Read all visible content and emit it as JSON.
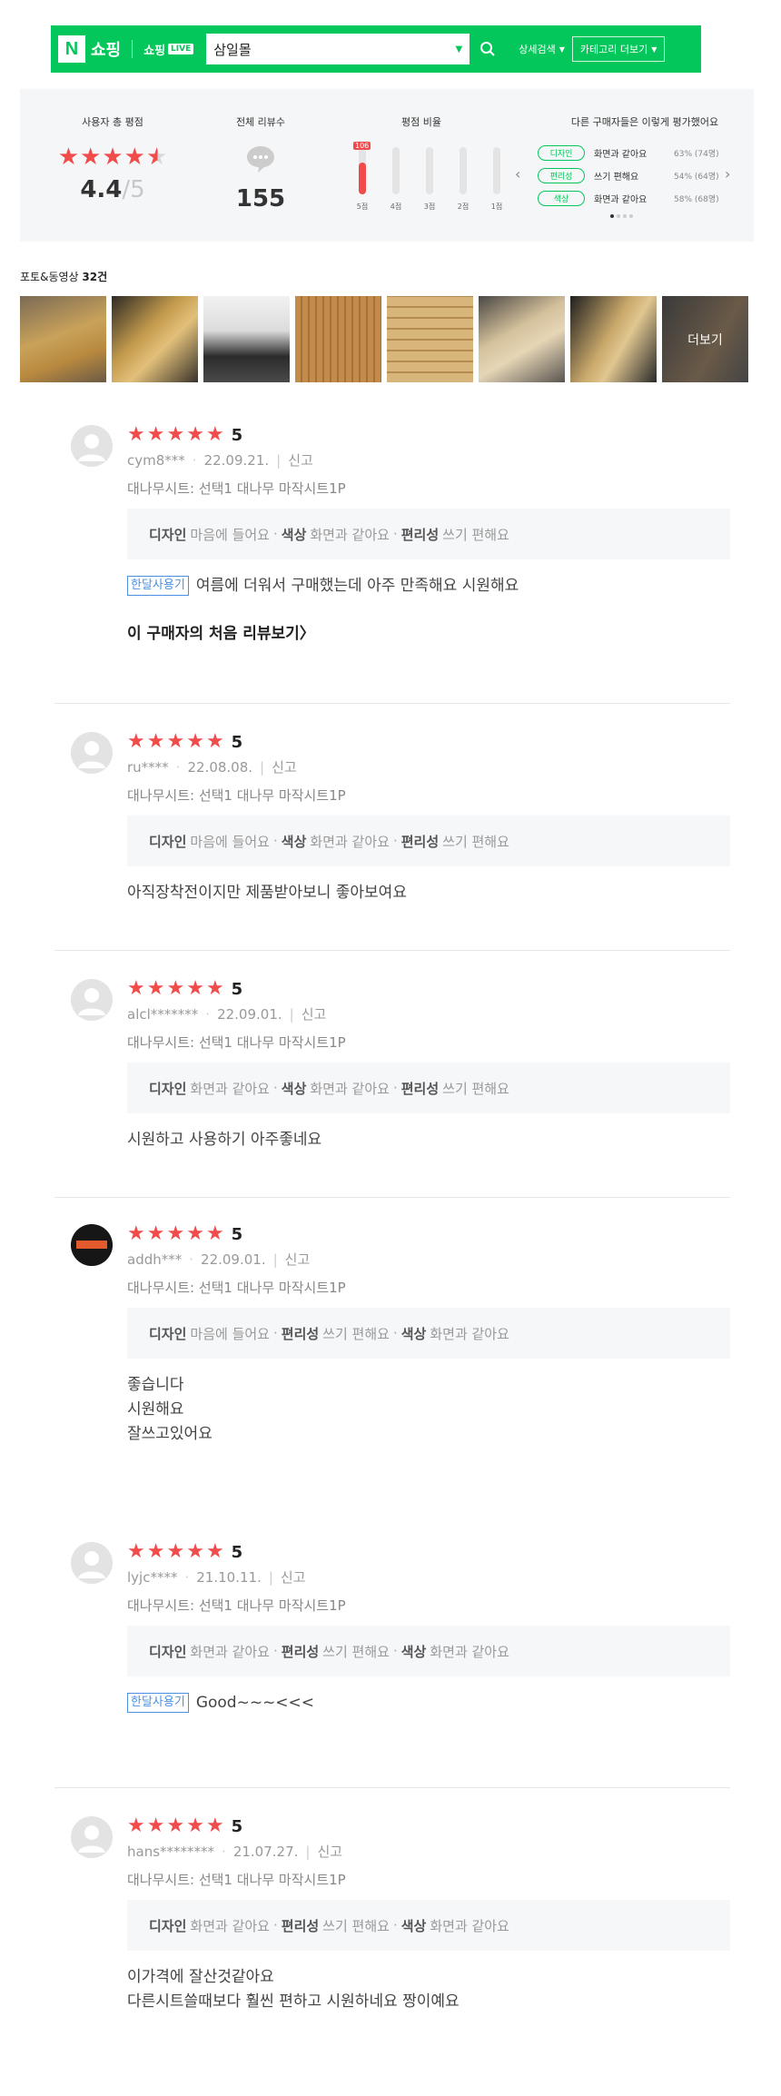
{
  "header": {
    "logo": "N",
    "shop": "쇼핑",
    "live_text": "쇼핑",
    "live_badge": "LIVE",
    "search_value": "삼일몰",
    "detail_search": "상세검색",
    "more_category": "카테고리 더보기"
  },
  "summary": {
    "user_rating_title": "사용자 총 평점",
    "avg": "4.4",
    "avg_max": "/5",
    "rating_value": 4.4,
    "total_title": "전체 리뷰수",
    "total": "155",
    "ratio_title": "평점 비율",
    "ratio": [
      {
        "label": "5점",
        "fraction": 0.68,
        "tag": "106"
      },
      {
        "label": "4점",
        "fraction": 0.0,
        "tag": ""
      },
      {
        "label": "3점",
        "fraction": 0.0,
        "tag": ""
      },
      {
        "label": "2점",
        "fraction": 0.0,
        "tag": ""
      },
      {
        "label": "1점",
        "fraction": 0.0,
        "tag": ""
      }
    ],
    "eval_title": "다른 구매자들은 이렇게 평가했어요",
    "evals": [
      {
        "tag": "디자인",
        "text": "화면과 같아요",
        "pct": "63% (74명)"
      },
      {
        "tag": "편리성",
        "text": "쓰기 편해요",
        "pct": "54% (64명)"
      },
      {
        "tag": "색상",
        "text": "화면과 같아요",
        "pct": "58% (68명)"
      }
    ]
  },
  "photos": {
    "title_prefix": "포토&동영상",
    "count": "32건",
    "more": "더보기"
  },
  "reviews": [
    {
      "score": "5",
      "user": "cym8***",
      "date": "22.09.21.",
      "report": "신고",
      "option": "대나무시트: 선택1 대나무 마작시트1P",
      "evals": [
        {
          "k": "디자인",
          "v": "마음에 들어요"
        },
        {
          "k": "색상",
          "v": "화면과 같아요"
        },
        {
          "k": "편리성",
          "v": "쓰기 편해요"
        }
      ],
      "tag": "한달사용기",
      "text": "여름에 더워서 구매했는데 아주 만족해요 시원해요",
      "first_review": "이 구매자의 처음 리뷰보기〉"
    },
    {
      "score": "5",
      "user": "ru****",
      "date": "22.08.08.",
      "report": "신고",
      "option": "대나무시트: 선택1 대나무 마작시트1P",
      "evals": [
        {
          "k": "디자인",
          "v": "마음에 들어요"
        },
        {
          "k": "색상",
          "v": "화면과 같아요"
        },
        {
          "k": "편리성",
          "v": "쓰기 편해요"
        }
      ],
      "text": "아직장착전이지만 제품받아보니 좋아보여요"
    },
    {
      "score": "5",
      "user": "alcl*******",
      "date": "22.09.01.",
      "report": "신고",
      "option": "대나무시트: 선택1 대나무 마작시트1P",
      "evals": [
        {
          "k": "디자인",
          "v": "화면과 같아요"
        },
        {
          "k": "색상",
          "v": "화면과 같아요"
        },
        {
          "k": "편리성",
          "v": "쓰기 편해요"
        }
      ],
      "text": "시원하고 사용하기 아주좋네요"
    },
    {
      "score": "5",
      "user": "addh***",
      "date": "22.09.01.",
      "report": "신고",
      "option": "대나무시트: 선택1 대나무 마작시트1P",
      "evals": [
        {
          "k": "디자인",
          "v": "마음에 들어요"
        },
        {
          "k": "편리성",
          "v": "쓰기 편해요"
        },
        {
          "k": "색상",
          "v": "화면과 같아요"
        }
      ],
      "text_lines": [
        "좋습니다",
        "시원해요",
        "잘쓰고있어요"
      ]
    },
    {
      "score": "5",
      "user": "lyjc****",
      "date": "21.10.11.",
      "report": "신고",
      "option": "대나무시트: 선택1 대나무 마작시트1P",
      "evals": [
        {
          "k": "디자인",
          "v": "화면과 같아요"
        },
        {
          "k": "편리성",
          "v": "쓰기 편해요"
        },
        {
          "k": "색상",
          "v": "화면과 같아요"
        }
      ],
      "tag": "한달사용기",
      "text": "Good~~~<<<"
    },
    {
      "score": "5",
      "user": "hans********",
      "date": "21.07.27.",
      "report": "신고",
      "option": "대나무시트: 선택1 대나무 마작시트1P",
      "evals": [
        {
          "k": "디자인",
          "v": "화면과 같아요"
        },
        {
          "k": "편리성",
          "v": "쓰기 편해요"
        },
        {
          "k": "색상",
          "v": "화면과 같아요"
        }
      ],
      "text_lines": [
        "이가격에 잘산것같아요",
        "다른시트쓸때보다 훨씬 편하고 시원하네요 짱이예요"
      ]
    }
  ]
}
